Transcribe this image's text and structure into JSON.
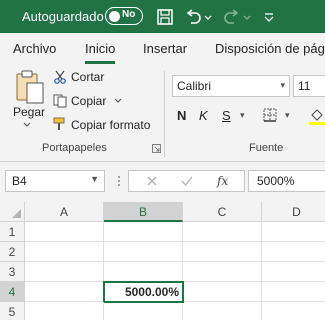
{
  "titlebar": {
    "autosave_label": "Autoguardado",
    "autosave_state": "No",
    "icons": [
      "save-icon",
      "undo-icon",
      "undo-dropdown-icon",
      "redo-icon",
      "redo-dropdown-icon",
      "customize-toolbar-icon"
    ]
  },
  "tabs": [
    {
      "label": "Archivo"
    },
    {
      "label": "Inicio",
      "active": true
    },
    {
      "label": "Insertar"
    },
    {
      "label": "Disposición de pág"
    }
  ],
  "ribbon": {
    "clipboard": {
      "paste_label": "Pegar",
      "cut_label": "Cortar",
      "copy_label": "Copiar",
      "format_painter_label": "Copiar formato",
      "group_label": "Portapapeles"
    },
    "font": {
      "font_name": "Calibri",
      "font_size": "11",
      "bold": "N",
      "italic": "K",
      "underline": "S",
      "group_label": "Fuente"
    }
  },
  "formula_bar": {
    "name_box": "B4",
    "fx_label": "fx",
    "value": "5000%"
  },
  "grid": {
    "columns": [
      "A",
      "B",
      "C",
      "D"
    ],
    "rows": [
      "1",
      "2",
      "3",
      "4",
      "5"
    ],
    "active_cell_value": "5000.00%"
  },
  "colors": {
    "brand_green": "#217346",
    "ribbon_bg": "#f3f3f3"
  }
}
